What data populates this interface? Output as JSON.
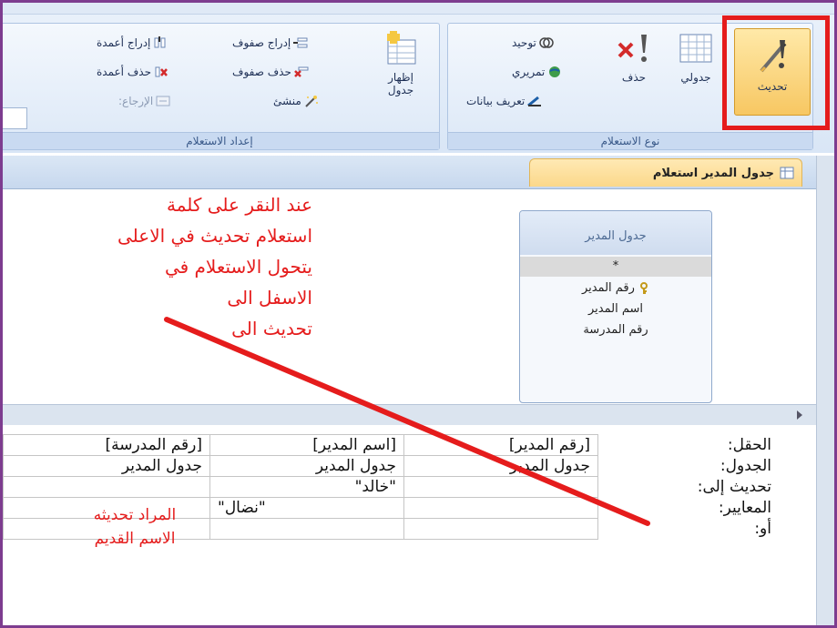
{
  "ribbon": {
    "setup_group": {
      "label": "إعداد الاستعلام",
      "insert_columns": "إدراج أعمدة",
      "delete_columns": "حذف أعمدة",
      "return_label": "الإرجاع:",
      "insert_rows": "إدراج صفوف",
      "delete_rows": "حذف صفوف",
      "builder": "منشئ",
      "show_table_line1": "إظهار",
      "show_table_line2": "جدول"
    },
    "type_group": {
      "label": "نوع الاستعلام",
      "union": "توحيد",
      "passthrough": "تمريري",
      "data_definition": "تعريف بيانات",
      "delete": "حذف",
      "crosstab": "جدولي",
      "update": "تحديث"
    }
  },
  "tab": {
    "title": "جدول المدير استعلام"
  },
  "table_box": {
    "title": "جدول المدير",
    "fields": [
      "*",
      "رقم المدير",
      "اسم المدير",
      "رقم المدرسة"
    ]
  },
  "annotation_main": "عند النقر على كلمة\nاستعلام تحديث في الاعلى\nيتحول الاستعلام في\nالاسفل الى\nتحديث الى",
  "annotation_grid": "المراد تحديثه\nالاسم القديم",
  "grid": {
    "row_labels": [
      "الحقل:",
      "الجدول:",
      "تحديث إلى:",
      "المعايير:",
      "أو:"
    ],
    "columns": [
      {
        "field": "[رقم المدير]",
        "table": "جدول المدير",
        "update_to": "",
        "criteria": ""
      },
      {
        "field": "[اسم المدير]",
        "table": "جدول المدير",
        "update_to": "\"خالد\"",
        "criteria": "\"نضال\""
      },
      {
        "field": "[رقم المدرسة]",
        "table": "جدول المدير",
        "update_to": "",
        "criteria": ""
      }
    ]
  },
  "colors": {
    "highlight": "#e51c1c",
    "frame": "#7d3c8f",
    "tab_active": "#fbd88a"
  }
}
